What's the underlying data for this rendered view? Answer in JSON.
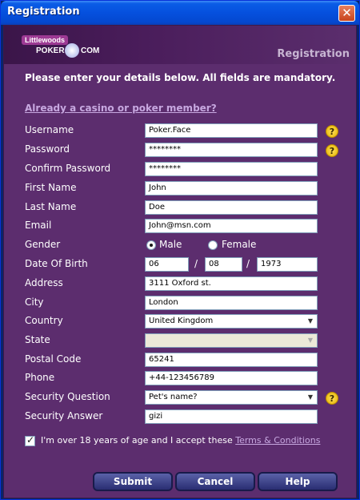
{
  "window": {
    "title": "Registration",
    "close_symbol": "✕"
  },
  "header": {
    "logo_badge": "Littlewoods",
    "logo_poker": "POKER",
    "logo_com": "COM",
    "section_title": "Registration"
  },
  "form": {
    "intro": "Please enter your details below.  All fields are mandatory.",
    "member_link": "Already a casino or poker member?",
    "labels": {
      "username": "Username",
      "password": "Password",
      "confirm_password": "Confirm Password",
      "first_name": "First Name",
      "last_name": "Last Name",
      "email": "Email",
      "gender": "Gender",
      "dob": "Date Of Birth",
      "address": "Address",
      "city": "City",
      "country": "Country",
      "state": "State",
      "postal_code": "Postal Code",
      "phone": "Phone",
      "security_question": "Security Question",
      "security_answer": "Security Answer"
    },
    "values": {
      "username": "Poker.Face",
      "password": "********",
      "confirm_password": "********",
      "first_name": "John",
      "last_name": "Doe",
      "email": "John@msn.com",
      "dob_day": "06",
      "dob_month": "08",
      "dob_year": "1973",
      "address": "3111 Oxford st.",
      "city": "London",
      "country": "United Kingdom",
      "state": "",
      "postal_code": "65241",
      "phone": "+44-123456789",
      "security_question": "Pet's name?",
      "security_answer": "gizi"
    },
    "gender_options": {
      "male": "Male",
      "female": "Female",
      "selected": "male"
    },
    "dob_separator": "/",
    "help_symbol": "?",
    "agree_text": "I'm over 18 years of age and I accept these ",
    "terms_link": "Terms & Conditions",
    "agree_checked": true
  },
  "buttons": {
    "submit": "Submit",
    "cancel": "Cancel",
    "help": "Help"
  },
  "colors": {
    "title_bar": "#0550DE",
    "panel": "#5C2D6E",
    "link": "#C7A8E0",
    "button": "#2A2E72"
  }
}
